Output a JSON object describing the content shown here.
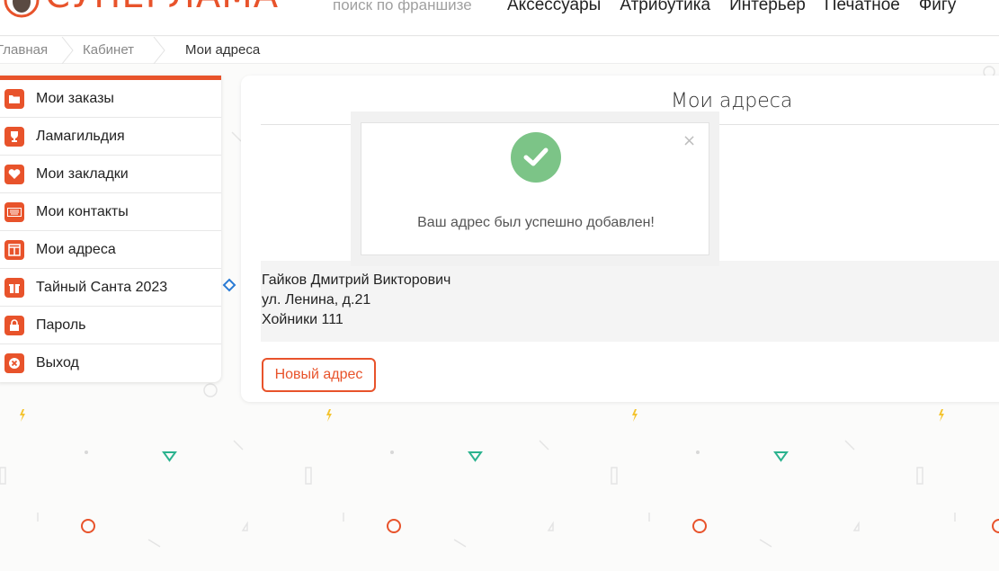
{
  "header": {
    "logo_text": "СУПЕРЛАМА",
    "search_placeholder": "поиск по франшизе",
    "nav": [
      "Аксессуары",
      "Атрибутика",
      "Интерьер",
      "Печатное",
      "Фигу"
    ]
  },
  "breadcrumb": {
    "items": [
      "Главная",
      "Кабинет",
      "Мои адреса"
    ]
  },
  "sidebar": {
    "items": [
      {
        "label": "Мои заказы",
        "icon": "folder-icon"
      },
      {
        "label": "Ламагильдия",
        "icon": "trophy-icon"
      },
      {
        "label": "Мои закладки",
        "icon": "heart-icon"
      },
      {
        "label": "Мои контакты",
        "icon": "keyboard-icon"
      },
      {
        "label": "Мои адреса",
        "icon": "columns-icon"
      },
      {
        "label": "Тайный Санта 2023",
        "icon": "gift-icon"
      },
      {
        "label": "Пароль",
        "icon": "lock-icon"
      },
      {
        "label": "Выход",
        "icon": "close-circle-icon"
      }
    ]
  },
  "main": {
    "title": "Мои адреса",
    "address": {
      "name": "Гайков Дмитрий Викторович",
      "street": "ул. Ленина, д.21",
      "city": "Хойники 111"
    },
    "new_address_button": "Новый адрес"
  },
  "modal": {
    "message": "Ваш адрес был успешно добавлен!",
    "close_symbol": "×",
    "icon": "check-circle-icon"
  },
  "colors": {
    "accent": "#e8532b",
    "success": "#7cc487",
    "pattern_teal": "#2bb38f",
    "pattern_yellow": "#f4c430",
    "pattern_blue": "#2a7bd5"
  }
}
